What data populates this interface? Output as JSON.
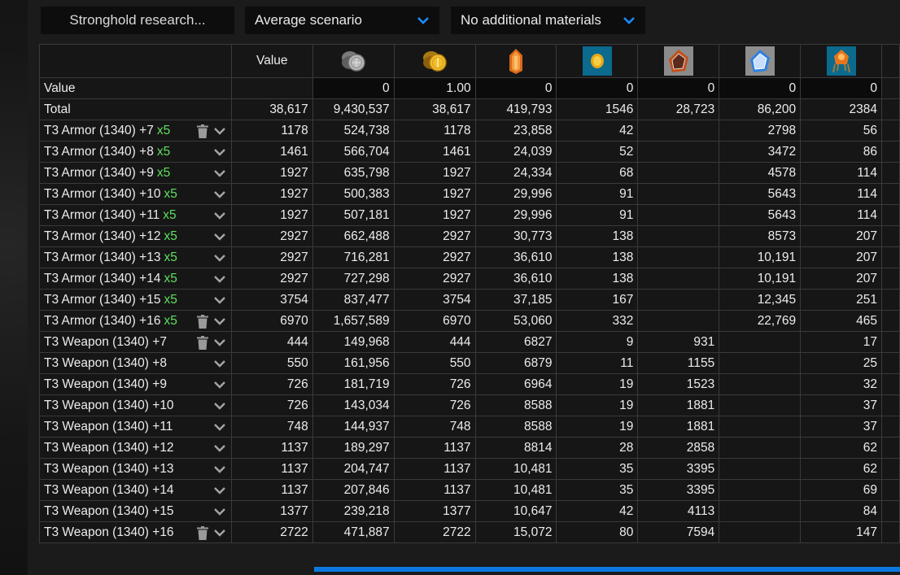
{
  "toolbar": {
    "search_label": "Stronghold research...",
    "scenario_select": "Average scenario",
    "materials_select": "No additional materials"
  },
  "colors": {
    "accent": "#1a8cff",
    "x5_green": "#5fe05f",
    "scrollbar": "#0a7ae0"
  },
  "table": {
    "header": {
      "value_label": "Value",
      "icons": [
        "silver-coin-icon",
        "gold-coin-icon",
        "amber-crystal-icon",
        "gold-gem-blue-icon",
        "fire-stone-icon",
        "ice-stone-icon",
        "ornate-chest-icon"
      ]
    },
    "value_row": {
      "label": "Value",
      "inputs": [
        "0",
        "1.00",
        "0",
        "0",
        "0",
        "0",
        "0"
      ]
    },
    "total_row": {
      "label": "Total",
      "value": "38,617",
      "cells": [
        "9,430,537",
        "38,617",
        "419,793",
        "1546",
        "28,723",
        "86,200",
        "2384"
      ]
    },
    "rows": [
      {
        "name": "T3 Armor (1340) +7",
        "mult": "x5",
        "trash": true,
        "value": "1178",
        "cells": [
          "524,738",
          "1178",
          "23,858",
          "42",
          "",
          "2798",
          "56"
        ]
      },
      {
        "name": "T3 Armor (1340) +8",
        "mult": "x5",
        "trash": false,
        "value": "1461",
        "cells": [
          "566,704",
          "1461",
          "24,039",
          "52",
          "",
          "3472",
          "86"
        ]
      },
      {
        "name": "T3 Armor (1340) +9",
        "mult": "x5",
        "trash": false,
        "value": "1927",
        "cells": [
          "635,798",
          "1927",
          "24,334",
          "68",
          "",
          "4578",
          "114"
        ]
      },
      {
        "name": "T3 Armor (1340) +10",
        "mult": "x5",
        "trash": false,
        "value": "1927",
        "cells": [
          "500,383",
          "1927",
          "29,996",
          "91",
          "",
          "5643",
          "114"
        ]
      },
      {
        "name": "T3 Armor (1340) +11",
        "mult": "x5",
        "trash": false,
        "value": "1927",
        "cells": [
          "507,181",
          "1927",
          "29,996",
          "91",
          "",
          "5643",
          "114"
        ]
      },
      {
        "name": "T3 Armor (1340) +12",
        "mult": "x5",
        "trash": false,
        "value": "2927",
        "cells": [
          "662,488",
          "2927",
          "30,773",
          "138",
          "",
          "8573",
          "207"
        ]
      },
      {
        "name": "T3 Armor (1340) +13",
        "mult": "x5",
        "trash": false,
        "value": "2927",
        "cells": [
          "716,281",
          "2927",
          "36,610",
          "138",
          "",
          "10,191",
          "207"
        ]
      },
      {
        "name": "T3 Armor (1340) +14",
        "mult": "x5",
        "trash": false,
        "value": "2927",
        "cells": [
          "727,298",
          "2927",
          "36,610",
          "138",
          "",
          "10,191",
          "207"
        ]
      },
      {
        "name": "T3 Armor (1340) +15",
        "mult": "x5",
        "trash": false,
        "value": "3754",
        "cells": [
          "837,477",
          "3754",
          "37,185",
          "167",
          "",
          "12,345",
          "251"
        ]
      },
      {
        "name": "T3 Armor (1340) +16",
        "mult": "x5",
        "trash": true,
        "value": "6970",
        "cells": [
          "1,657,589",
          "6970",
          "53,060",
          "332",
          "",
          "22,769",
          "465"
        ]
      },
      {
        "name": "T3 Weapon (1340) +7",
        "mult": "",
        "trash": true,
        "value": "444",
        "cells": [
          "149,968",
          "444",
          "6827",
          "9",
          "931",
          "",
          "17"
        ]
      },
      {
        "name": "T3 Weapon (1340) +8",
        "mult": "",
        "trash": false,
        "value": "550",
        "cells": [
          "161,956",
          "550",
          "6879",
          "11",
          "1155",
          "",
          "25"
        ]
      },
      {
        "name": "T3 Weapon (1340) +9",
        "mult": "",
        "trash": false,
        "value": "726",
        "cells": [
          "181,719",
          "726",
          "6964",
          "19",
          "1523",
          "",
          "32"
        ]
      },
      {
        "name": "T3 Weapon (1340) +10",
        "mult": "",
        "trash": false,
        "value": "726",
        "cells": [
          "143,034",
          "726",
          "8588",
          "19",
          "1881",
          "",
          "37"
        ]
      },
      {
        "name": "T3 Weapon (1340) +11",
        "mult": "",
        "trash": false,
        "value": "748",
        "cells": [
          "144,937",
          "748",
          "8588",
          "19",
          "1881",
          "",
          "37"
        ]
      },
      {
        "name": "T3 Weapon (1340) +12",
        "mult": "",
        "trash": false,
        "value": "1137",
        "cells": [
          "189,297",
          "1137",
          "8814",
          "28",
          "2858",
          "",
          "62"
        ]
      },
      {
        "name": "T3 Weapon (1340) +13",
        "mult": "",
        "trash": false,
        "value": "1137",
        "cells": [
          "204,747",
          "1137",
          "10,481",
          "35",
          "3395",
          "",
          "62"
        ]
      },
      {
        "name": "T3 Weapon (1340) +14",
        "mult": "",
        "trash": false,
        "value": "1137",
        "cells": [
          "207,846",
          "1137",
          "10,481",
          "35",
          "3395",
          "",
          "69"
        ]
      },
      {
        "name": "T3 Weapon (1340) +15",
        "mult": "",
        "trash": false,
        "value": "1377",
        "cells": [
          "239,218",
          "1377",
          "10,647",
          "42",
          "4113",
          "",
          "84"
        ]
      },
      {
        "name": "T3 Weapon (1340) +16",
        "mult": "",
        "trash": true,
        "value": "2722",
        "cells": [
          "471,887",
          "2722",
          "15,072",
          "80",
          "7594",
          "",
          "147"
        ]
      }
    ]
  }
}
